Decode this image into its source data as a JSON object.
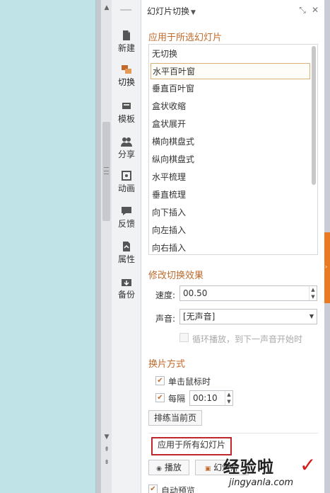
{
  "rail": {
    "items": [
      {
        "label": "新建",
        "icon": "new-doc-icon"
      },
      {
        "label": "切换",
        "icon": "transition-icon"
      },
      {
        "label": "模板",
        "icon": "template-icon"
      },
      {
        "label": "分享",
        "icon": "share-icon"
      },
      {
        "label": "动画",
        "icon": "animation-icon"
      },
      {
        "label": "反馈",
        "icon": "feedback-icon"
      },
      {
        "label": "属性",
        "icon": "properties-icon"
      },
      {
        "label": "备份",
        "icon": "backup-icon"
      }
    ]
  },
  "panel": {
    "title": "幻灯片切换",
    "apply_section_title": "应用于所选幻灯片",
    "transitions": [
      "无切换",
      "水平百叶窗",
      "垂直百叶窗",
      "盒状收缩",
      "盒状展开",
      "横向棋盘式",
      "纵向棋盘式",
      "水平梳理",
      "垂直梳理",
      "向下插入",
      "向左插入",
      "向右插入"
    ],
    "selected_transition": "水平百叶窗",
    "modify_section_title": "修改切换效果",
    "speed_label": "速度:",
    "speed_value": "00.50",
    "sound_label": "声音:",
    "sound_value": "[无声音]",
    "loop_label": "循环播放，到下一声音开始时",
    "advance_section_title": "换片方式",
    "on_click_label": "单击鼠标时",
    "on_click_checked": true,
    "every_label": "每隔",
    "every_checked": true,
    "every_value": "00:10",
    "rehearse_label": "排练当前页",
    "apply_all_label": "应用于所有幻灯片",
    "play_label": "播放",
    "slideshow_label": "幻灯片",
    "autopreview_label": "自动预览"
  },
  "watermark": {
    "logo_text": "经验啦",
    "url_text": "jingyanla.com"
  },
  "colors": {
    "accent": "#c06a2b",
    "highlight_border": "#c0262e",
    "slide_bg": "#bfe3e6",
    "side_tab": "#e97a22"
  }
}
